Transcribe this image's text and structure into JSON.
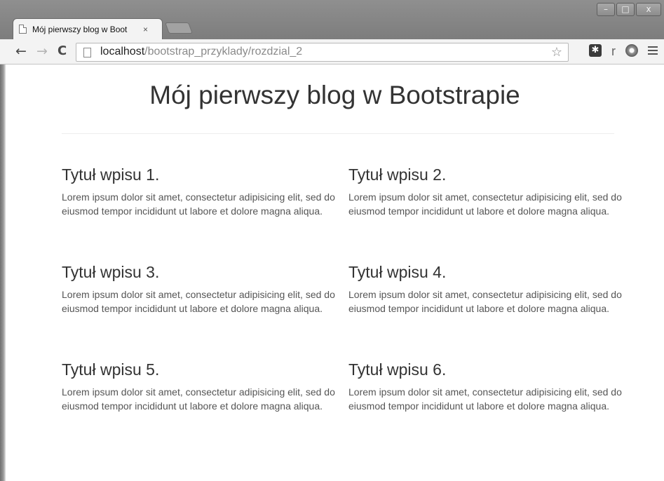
{
  "browser": {
    "tab_title": "Mój pierwszy blog w Boot",
    "tab_close": "×",
    "url_host": "localhost",
    "url_path": "/bootstrap_przyklady/rozdzial_2",
    "window_controls": {
      "minimize": "–",
      "maximize": "□",
      "close": "x"
    },
    "nav": {
      "back": "←",
      "forward": "→",
      "reload": "C"
    },
    "star": "☆",
    "extensions": [
      "puzzle-extension-icon",
      "r-extension-icon",
      "film-reel-extension-icon"
    ],
    "extension_r_label": "r"
  },
  "page": {
    "heading": "Mój pierwszy blog w Bootstrapie",
    "posts": [
      {
        "title": "Tytuł wpisu 1.",
        "body": "Lorem ipsum dolor sit amet, consectetur adipisicing elit, sed do eiusmod tempor incididunt ut labore et dolore magna aliqua."
      },
      {
        "title": "Tytuł wpisu 2.",
        "body": "Lorem ipsum dolor sit amet, consectetur adipisicing elit, sed do eiusmod tempor incididunt ut labore et dolore magna aliqua."
      },
      {
        "title": "Tytuł wpisu 3.",
        "body": "Lorem ipsum dolor sit amet, consectetur adipisicing elit, sed do eiusmod tempor incididunt ut labore et dolore magna aliqua."
      },
      {
        "title": "Tytuł wpisu 4.",
        "body": "Lorem ipsum dolor sit amet, consectetur adipisicing elit, sed do eiusmod tempor incididunt ut labore et dolore magna aliqua."
      },
      {
        "title": "Tytuł wpisu 5.",
        "body": "Lorem ipsum dolor sit amet, consectetur adipisicing elit, sed do eiusmod tempor incididunt ut labore et dolore magna aliqua."
      },
      {
        "title": "Tytuł wpisu 6.",
        "body": "Lorem ipsum dolor sit amet, consectetur adipisicing elit, sed do eiusmod tempor incididunt ut labore et dolore magna aliqua."
      }
    ]
  },
  "colors": {
    "heading": "#333333",
    "body_text": "#555555",
    "chrome_frame": "#8a8a8a",
    "toolbar": "#f3f3f3",
    "url_path": "#8a8a8a"
  }
}
